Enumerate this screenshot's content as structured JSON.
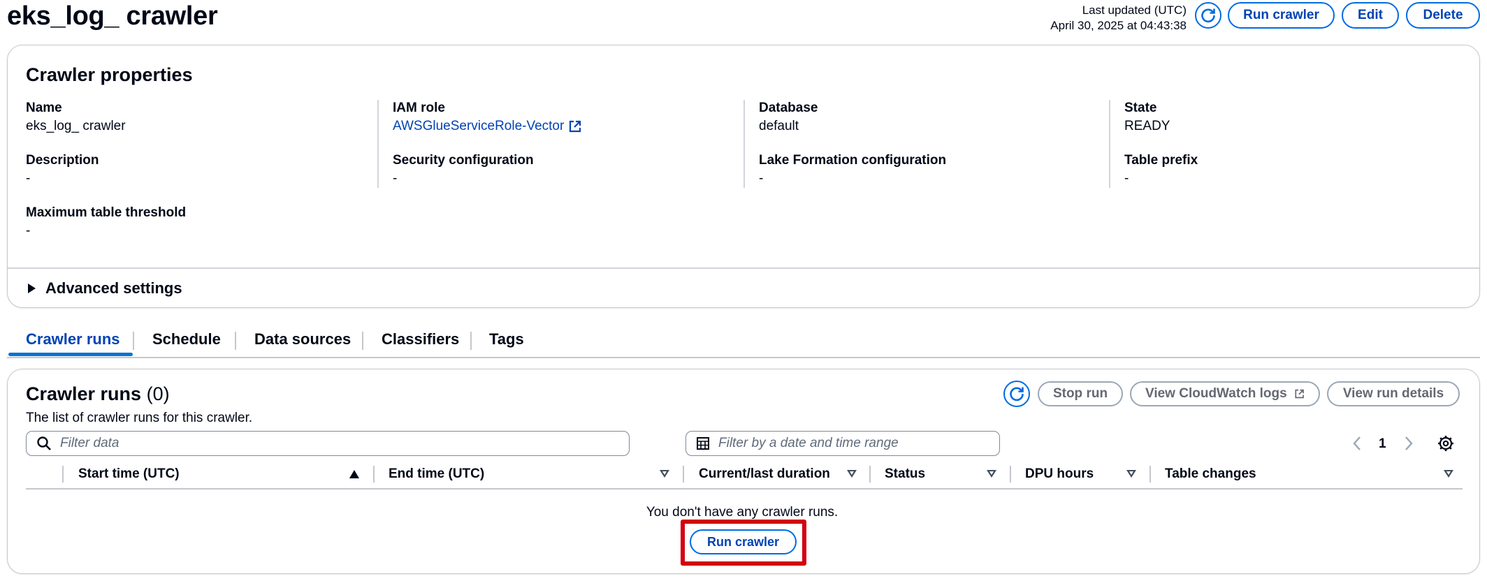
{
  "page": {
    "title": "eks_log_ crawler",
    "last_updated_label": "Last updated (UTC)",
    "last_updated_value": "April 30, 2025 at 04:43:38",
    "header_buttons": {
      "run": "Run crawler",
      "edit": "Edit",
      "delete": "Delete"
    }
  },
  "properties": {
    "title": "Crawler properties",
    "items": [
      {
        "label": "Name",
        "value": "eks_log_ crawler"
      },
      {
        "label": "IAM role",
        "value": "AWSGlueServiceRole-Vector"
      },
      {
        "label": "Database",
        "value": "default"
      },
      {
        "label": "State",
        "value": "READY"
      },
      {
        "label": "Description",
        "value": "-"
      },
      {
        "label": "Security configuration",
        "value": "-"
      },
      {
        "label": "Lake Formation configuration",
        "value": "-"
      },
      {
        "label": "Table prefix",
        "value": "-"
      },
      {
        "label": "Maximum table threshold",
        "value": "-"
      }
    ],
    "advanced": "Advanced settings"
  },
  "tabs": [
    {
      "label": "Crawler runs",
      "active": true
    },
    {
      "label": "Schedule"
    },
    {
      "label": "Data sources"
    },
    {
      "label": "Classifiers"
    },
    {
      "label": "Tags"
    }
  ],
  "runs": {
    "title": "Crawler runs",
    "count": "(0)",
    "description": "The list of crawler runs for this crawler.",
    "buttons": {
      "stop": "Stop run",
      "cloudwatch": "View CloudWatch logs",
      "details": "View run details"
    },
    "filter_placeholder": "Filter data",
    "date_placeholder": "Filter by a date and time range",
    "page": "1",
    "columns": [
      "Start time (UTC)",
      "End time (UTC)",
      "Current/last duration",
      "Status",
      "DPU hours",
      "Table changes"
    ],
    "empty_message": "You don't have any crawler runs.",
    "empty_button": "Run crawler"
  },
  "colors": {
    "accent": "#006ce0",
    "link": "#0043b3",
    "highlight": "#d4000f"
  },
  "icons": [
    "refresh-icon",
    "external-link-icon",
    "search-icon",
    "calendar-icon",
    "chevron-left-icon",
    "chevron-right-icon",
    "gear-icon",
    "caret-right-icon"
  ]
}
